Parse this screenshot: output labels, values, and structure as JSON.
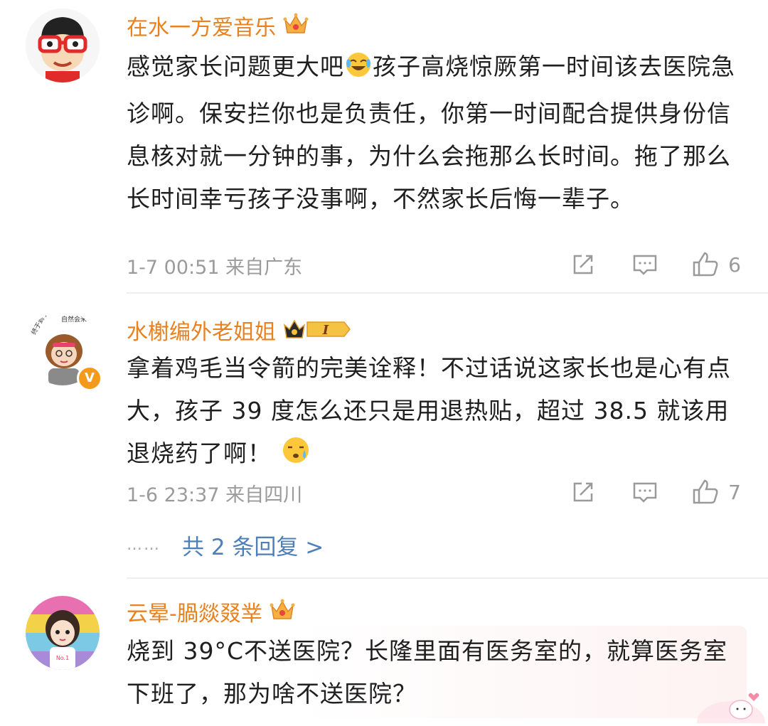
{
  "comments": [
    {
      "username": "在水一方爱音乐",
      "text_parts": [
        "感觉家长问题更大吧",
        "孩子高烧惊厥第一时间该去医院急诊啊。保安拦你也是负责任，你第一时间配合提供身份信息核对就一分钟的事，为什么会拖那么长时间。拖了那么长时间幸亏孩子没事啊，不然家长后悔一辈子。"
      ],
      "inline_emoji": "crying-laughing-emoji",
      "meta": "1-7 00:51 来自广东",
      "likes": "6",
      "badge": "crown-icon"
    },
    {
      "username": "水榭编外老姐姐",
      "text_parts": [
        "拿着鸡毛当令箭的完美诠释！不过话说这家长也是心有点大，孩子 39 度怎么还只是用退热贴，超过 38.5 就该用退烧药了啊！",
        ""
      ],
      "inline_emoji": "sweat-emoji",
      "meta": "1-6 23:37 来自四川",
      "likes": "7",
      "badge": "vip-crown-badge",
      "badge_text": "I",
      "verified_mark": "V",
      "avatar_caption_left": "终于到了",
      "avatar_caption_right": "自然会来看我",
      "replies_dots": "……",
      "replies_label": "共 2 条回复 >"
    },
    {
      "username": "云晕-腡燚叕丵",
      "text_parts": [
        "烧到 39°C不送医院？长隆里面有医务室的，就算医务室下班了，那为啥不送医院？",
        ""
      ],
      "badge": "crown-icon",
      "shirt_label": "No.1"
    }
  ],
  "colors": {
    "username": "#e8811f",
    "meta": "#9b9b9b",
    "link": "#4e7fb8",
    "verified": "#f49a1a"
  },
  "icons": [
    "share-icon",
    "comment-icon",
    "like-icon"
  ]
}
